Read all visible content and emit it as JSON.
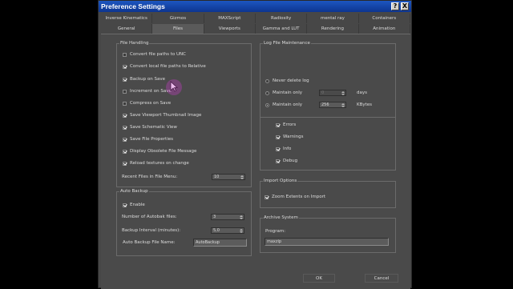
{
  "window": {
    "title": "Preference Settings",
    "help_label": "?",
    "close_label": "X"
  },
  "tabs": {
    "row1": [
      "Inverse Kinematics",
      "Gizmos",
      "MAXScript",
      "Radiosity",
      "mental ray",
      "Containers"
    ],
    "row2": [
      "General",
      "Files",
      "Viewports",
      "Gamma and LUT",
      "Rendering",
      "Animation"
    ],
    "active": "Files"
  },
  "file_handling": {
    "title": "File Handling",
    "options": [
      {
        "label": "Convert file paths to UNC",
        "checked": false
      },
      {
        "label": "Convert local file paths to Relative",
        "checked": true
      },
      {
        "label": "Backup on Save",
        "checked": true
      },
      {
        "label": "Increment on Save",
        "checked": false
      },
      {
        "label": "Compress on Save",
        "checked": false
      },
      {
        "label": "Save Viewport Thumbnail Image",
        "checked": true
      },
      {
        "label": "Save Schematic View",
        "checked": true
      },
      {
        "label": "Save File Properties",
        "checked": true
      },
      {
        "label": "Display Obsolete File Message",
        "checked": true
      },
      {
        "label": "Reload textures on change",
        "checked": true
      }
    ],
    "recent_files_label": "Recent Files in File Menu:",
    "recent_files_value": "10"
  },
  "auto_backup": {
    "title": "Auto Backup",
    "enable_label": "Enable",
    "enable_checked": true,
    "num_files_label": "Number of Autobak files:",
    "num_files_value": "3",
    "interval_label": "Backup Interval (minutes):",
    "interval_value": "5,0",
    "file_name_label": "Auto Backup File Name:",
    "file_name_value": "AutoBackup"
  },
  "log_maintenance": {
    "title": "Log File Maintenance",
    "never_delete_label": "Never delete log",
    "maintain_days_label": "Maintain only",
    "maintain_days_value": "0",
    "days_unit": "days",
    "maintain_kb_label": "Maintain only",
    "maintain_kb_value": "256",
    "kb_unit": "KBytes",
    "selected": "kbytes",
    "levels": [
      {
        "label": "Errors",
        "checked": true
      },
      {
        "label": "Warnings",
        "checked": true
      },
      {
        "label": "Info",
        "checked": true
      },
      {
        "label": "Debug",
        "checked": true
      }
    ]
  },
  "import_options": {
    "title": "Import Options",
    "zoom_label": "Zoom Extents on Import",
    "zoom_checked": true
  },
  "archive_system": {
    "title": "Archive System",
    "program_label": "Program:",
    "program_value": "maxzip"
  },
  "buttons": {
    "ok": "OK",
    "cancel": "Cancel"
  }
}
